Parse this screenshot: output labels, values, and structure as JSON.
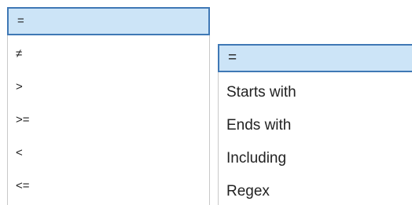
{
  "operator_dropdown": {
    "items": [
      {
        "label": "=",
        "selected": true
      },
      {
        "label": "≠",
        "selected": false
      },
      {
        "label": ">",
        "selected": false
      },
      {
        "label": ">=",
        "selected": false
      },
      {
        "label": "<",
        "selected": false
      },
      {
        "label": "<=",
        "selected": false
      }
    ]
  },
  "string_operator_dropdown": {
    "items": [
      {
        "label": "=",
        "selected": true
      },
      {
        "label": "Starts with",
        "selected": false
      },
      {
        "label": "Ends with",
        "selected": false
      },
      {
        "label": "Including",
        "selected": false
      },
      {
        "label": "Regex",
        "selected": false
      }
    ]
  },
  "colors": {
    "selected_background": "#cce4f7",
    "selected_border": "#3f78b5",
    "text": "#222222",
    "panel_border": "#c8c8c8"
  }
}
